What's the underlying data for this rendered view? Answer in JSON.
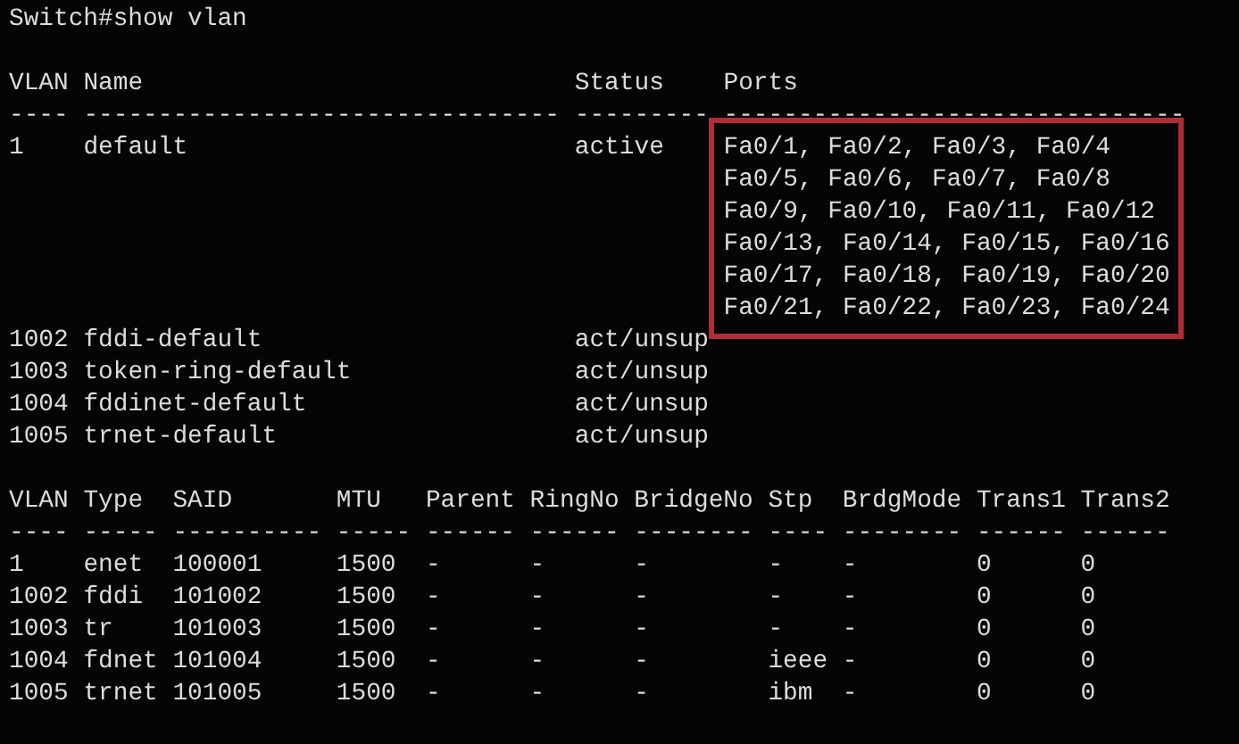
{
  "prompt": "Switch#show vlan",
  "vlan_table": {
    "columns": [
      {
        "label": "VLAN",
        "rule": "----"
      },
      {
        "label": "Name",
        "rule": "--------------------------------"
      },
      {
        "label": "Status",
        "rule": "---------"
      },
      {
        "label": "Ports",
        "rule": "-------------------------------"
      }
    ],
    "rows": [
      {
        "vlan": "1",
        "name": "default",
        "status": "active",
        "highlighted": true,
        "ports": [
          "Fa0/1, Fa0/2, Fa0/3, Fa0/4",
          "Fa0/5, Fa0/6, Fa0/7, Fa0/8",
          "Fa0/9, Fa0/10, Fa0/11, Fa0/12",
          "Fa0/13, Fa0/14, Fa0/15, Fa0/16",
          "Fa0/17, Fa0/18, Fa0/19, Fa0/20",
          "Fa0/21, Fa0/22, Fa0/23, Fa0/24"
        ]
      },
      {
        "vlan": "1002",
        "name": "fddi-default",
        "status": "act/unsup",
        "highlighted": false,
        "ports": []
      },
      {
        "vlan": "1003",
        "name": "token-ring-default",
        "status": "act/unsup",
        "highlighted": false,
        "ports": []
      },
      {
        "vlan": "1004",
        "name": "fddinet-default",
        "status": "act/unsup",
        "highlighted": false,
        "ports": []
      },
      {
        "vlan": "1005",
        "name": "trnet-default",
        "status": "act/unsup",
        "highlighted": false,
        "ports": []
      }
    ]
  },
  "type_table": {
    "columns": [
      {
        "label": "VLAN",
        "rule": "----"
      },
      {
        "label": "Type",
        "rule": "-----"
      },
      {
        "label": "SAID",
        "rule": "----------"
      },
      {
        "label": "MTU",
        "rule": "-----"
      },
      {
        "label": "Parent",
        "rule": "------"
      },
      {
        "label": "RingNo",
        "rule": "------"
      },
      {
        "label": "BridgeNo",
        "rule": "--------"
      },
      {
        "label": "Stp",
        "rule": "----"
      },
      {
        "label": "BrdgMode",
        "rule": "--------"
      },
      {
        "label": "Trans1",
        "rule": "------"
      },
      {
        "label": "Trans2",
        "rule": "------"
      }
    ],
    "rows": [
      [
        "1",
        "enet",
        "100001",
        "1500",
        "-",
        "-",
        "-",
        "-",
        "-",
        "0",
        "0"
      ],
      [
        "1002",
        "fddi",
        "101002",
        "1500",
        "-",
        "-",
        "-",
        "-",
        "-",
        "0",
        "0"
      ],
      [
        "1003",
        "tr",
        "101003",
        "1500",
        "-",
        "-",
        "-",
        "-",
        "-",
        "0",
        "0"
      ],
      [
        "1004",
        "fdnet",
        "101004",
        "1500",
        "-",
        "-",
        "-",
        "ieee",
        "-",
        "0",
        "0"
      ],
      [
        "1005",
        "trnet",
        "101005",
        "1500",
        "-",
        "-",
        "-",
        "ibm",
        "-",
        "0",
        "0"
      ]
    ]
  }
}
